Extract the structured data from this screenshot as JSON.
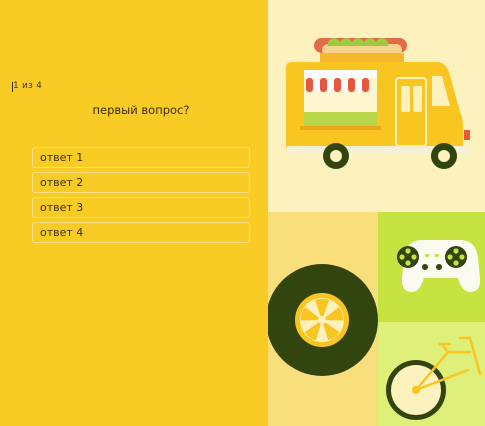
{
  "quiz": {
    "progress": "1 из 4",
    "question": "первый вопрос?",
    "answers": [
      {
        "label": "ответ 1"
      },
      {
        "label": "ответ 2"
      },
      {
        "label": "ответ 3"
      },
      {
        "label": "ответ 4"
      }
    ]
  },
  "colors": {
    "background_yellow": "#f8cc25",
    "truck_panel": "#fdf1bd",
    "wheel_panel": "#f9df7c",
    "gamepad_panel": "#c6e342",
    "bike_panel": "#dff07a",
    "dark_green": "#33450f"
  },
  "illustrations": [
    "food-truck-illustration",
    "wheel-illustration",
    "gamepad-illustration",
    "bicycle-illustration"
  ]
}
